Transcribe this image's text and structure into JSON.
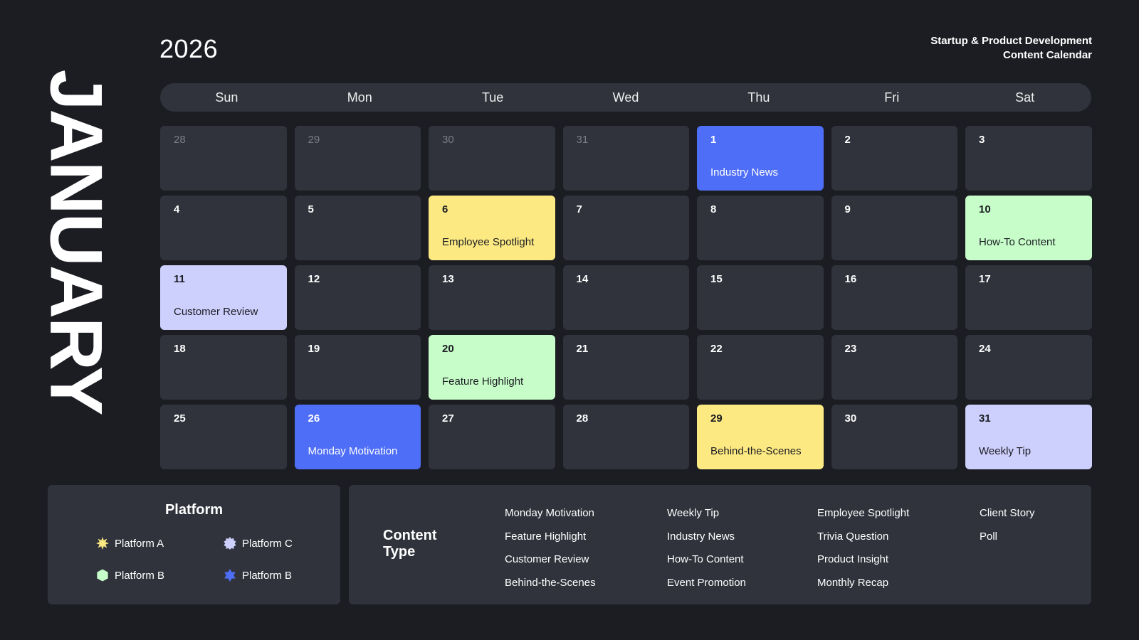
{
  "header": {
    "month": "JANUARY",
    "year": "2026",
    "subtitle_line1": "Startup & Product Development",
    "subtitle_line2": "Content Calendar"
  },
  "weekdays": [
    "Sun",
    "Mon",
    "Tue",
    "Wed",
    "Thu",
    "Fri",
    "Sat"
  ],
  "colors": {
    "background": "#1b1d23",
    "cell": "#30333c",
    "blue": "#4f6ef7",
    "yellow": "#fde982",
    "green": "#c7fdc9",
    "lavender": "#cdcffc",
    "muted_text": "#7a7d86"
  },
  "calendar": {
    "cells": [
      {
        "day": "28",
        "event": "",
        "style": "prev"
      },
      {
        "day": "29",
        "event": "",
        "style": "prev"
      },
      {
        "day": "30",
        "event": "",
        "style": "prev"
      },
      {
        "day": "31",
        "event": "",
        "style": "prev"
      },
      {
        "day": "1",
        "event": "Industry News",
        "style": "blue"
      },
      {
        "day": "2",
        "event": "",
        "style": ""
      },
      {
        "day": "3",
        "event": "",
        "style": ""
      },
      {
        "day": "4",
        "event": "",
        "style": ""
      },
      {
        "day": "5",
        "event": "",
        "style": ""
      },
      {
        "day": "6",
        "event": "Employee Spotlight",
        "style": "yellow"
      },
      {
        "day": "7",
        "event": "",
        "style": ""
      },
      {
        "day": "8",
        "event": "",
        "style": ""
      },
      {
        "day": "9",
        "event": "",
        "style": ""
      },
      {
        "day": "10",
        "event": "How-To Content",
        "style": "green"
      },
      {
        "day": "11",
        "event": "Customer Review",
        "style": "lav"
      },
      {
        "day": "12",
        "event": "",
        "style": ""
      },
      {
        "day": "13",
        "event": "",
        "style": ""
      },
      {
        "day": "14",
        "event": "",
        "style": ""
      },
      {
        "day": "15",
        "event": "",
        "style": ""
      },
      {
        "day": "16",
        "event": "",
        "style": ""
      },
      {
        "day": "17",
        "event": "",
        "style": ""
      },
      {
        "day": "18",
        "event": "",
        "style": ""
      },
      {
        "day": "19",
        "event": "",
        "style": ""
      },
      {
        "day": "20",
        "event": "Feature Highlight",
        "style": "green"
      },
      {
        "day": "21",
        "event": "",
        "style": ""
      },
      {
        "day": "22",
        "event": "",
        "style": ""
      },
      {
        "day": "23",
        "event": "",
        "style": ""
      },
      {
        "day": "24",
        "event": "",
        "style": ""
      },
      {
        "day": "25",
        "event": "",
        "style": ""
      },
      {
        "day": "26",
        "event": "Monday Motivation",
        "style": "blue"
      },
      {
        "day": "27",
        "event": "",
        "style": ""
      },
      {
        "day": "28",
        "event": "",
        "style": ""
      },
      {
        "day": "29",
        "event": "Behind-the-Scenes",
        "style": "yellow"
      },
      {
        "day": "30",
        "event": "",
        "style": ""
      },
      {
        "day": "31",
        "event": "Weekly Tip",
        "style": "lav"
      }
    ]
  },
  "platform_legend": {
    "title": "Platform",
    "items": [
      {
        "label": "Platform A",
        "icon": "sun-star-icon",
        "color": "#fde982"
      },
      {
        "label": "Platform C",
        "icon": "badge-star-icon",
        "color": "#cdcffc"
      },
      {
        "label": "Platform B",
        "icon": "hexagon-icon",
        "color": "#c7fdc9"
      },
      {
        "label": "Platform B",
        "icon": "six-point-star-icon",
        "color": "#4f6ef7"
      }
    ]
  },
  "content_type": {
    "title_line1": "Content",
    "title_line2": "Type",
    "columns": [
      [
        "Monday Motivation",
        "Feature Highlight",
        "Customer Review",
        "Behind-the-Scenes"
      ],
      [
        "Weekly Tip",
        "Industry News",
        "How-To Content",
        "Event Promotion"
      ],
      [
        "Employee Spotlight",
        "Trivia Question",
        "Product Insight",
        "Monthly Recap"
      ],
      [
        "Client Story",
        "Poll"
      ]
    ]
  }
}
